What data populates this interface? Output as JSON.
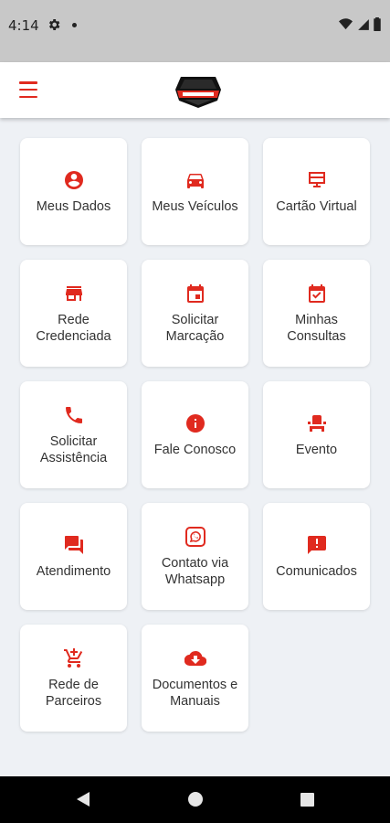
{
  "status_bar": {
    "time": "4:14"
  },
  "menu": [
    {
      "label": "Meus Dados",
      "icon": "account-circle-icon",
      "name": "meus-dados"
    },
    {
      "label": "Meus Veículos",
      "icon": "car-icon",
      "name": "meus-veiculos"
    },
    {
      "label": "Cartão Virtual",
      "icon": "card-monitor-icon",
      "name": "cartao-virtual"
    },
    {
      "label": "Rede\nCredenciada",
      "icon": "store-icon",
      "name": "rede-credenciada"
    },
    {
      "label": "Solicitar\nMarcação",
      "icon": "calendar-icon",
      "name": "solicitar-marcacao"
    },
    {
      "label": "Minhas\nConsultas",
      "icon": "calendar-check-icon",
      "name": "minhas-consultas"
    },
    {
      "label": "Solicitar\nAssistência",
      "icon": "phone-icon",
      "name": "solicitar-assistencia"
    },
    {
      "label": "Fale Conosco",
      "icon": "info-icon",
      "name": "fale-conosco"
    },
    {
      "label": "Evento",
      "icon": "event-seat-icon",
      "name": "evento"
    },
    {
      "label": "Atendimento",
      "icon": "forum-icon",
      "name": "atendimento"
    },
    {
      "label": "Contato via\nWhatsapp",
      "icon": "whatsapp-icon",
      "name": "contato-whatsapp"
    },
    {
      "label": "Comunicados",
      "icon": "announcement-icon",
      "name": "comunicados"
    },
    {
      "label": "Rede de\nParceiros",
      "icon": "cart-plus-icon",
      "name": "rede-parceiros"
    },
    {
      "label": "Documentos e\nManuais",
      "icon": "cloud-download-icon",
      "name": "documentos-manuais"
    }
  ],
  "colors": {
    "accent": "#e02a1f",
    "background": "#eef1f5",
    "card": "#ffffff"
  }
}
